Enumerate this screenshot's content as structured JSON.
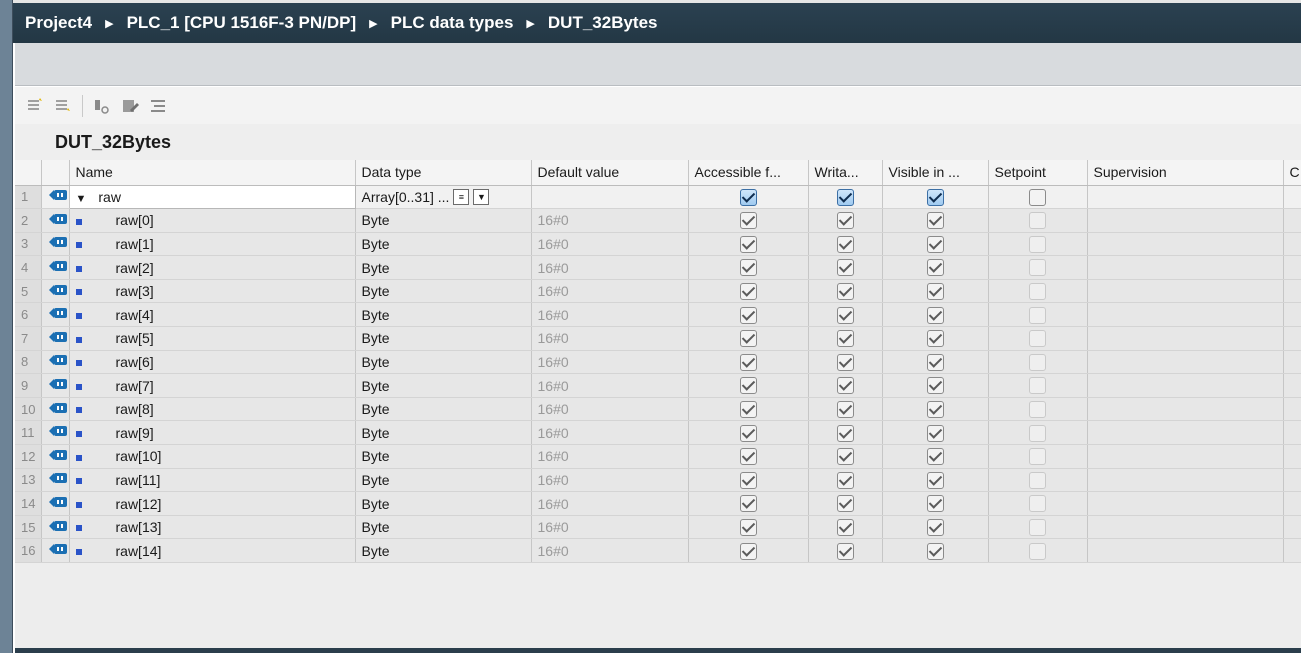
{
  "breadcrumb": [
    "Project4",
    "PLC_1 [CPU 1516F-3 PN/DP]",
    "PLC data types",
    "DUT_32Bytes"
  ],
  "breadcrumb_separator": "▶",
  "block_title": "DUT_32Bytes",
  "columns": {
    "name": "Name",
    "data_type": "Data type",
    "default_value": "Default value",
    "accessible": "Accessible f...",
    "writable": "Writa...",
    "visible": "Visible in ...",
    "setpoint": "Setpoint",
    "supervision": "Supervision",
    "extra": "C"
  },
  "first_row": {
    "num": "1",
    "name": "raw",
    "data_type": "Array[0..31] ...",
    "default_value": "",
    "accessible": true,
    "writable": true,
    "visible": true,
    "setpoint": false
  },
  "rows": [
    {
      "num": "2",
      "name": "raw[0]",
      "data_type": "Byte",
      "default_value": "16#0"
    },
    {
      "num": "3",
      "name": "raw[1]",
      "data_type": "Byte",
      "default_value": "16#0"
    },
    {
      "num": "4",
      "name": "raw[2]",
      "data_type": "Byte",
      "default_value": "16#0"
    },
    {
      "num": "5",
      "name": "raw[3]",
      "data_type": "Byte",
      "default_value": "16#0"
    },
    {
      "num": "6",
      "name": "raw[4]",
      "data_type": "Byte",
      "default_value": "16#0"
    },
    {
      "num": "7",
      "name": "raw[5]",
      "data_type": "Byte",
      "default_value": "16#0"
    },
    {
      "num": "8",
      "name": "raw[6]",
      "data_type": "Byte",
      "default_value": "16#0"
    },
    {
      "num": "9",
      "name": "raw[7]",
      "data_type": "Byte",
      "default_value": "16#0"
    },
    {
      "num": "10",
      "name": "raw[8]",
      "data_type": "Byte",
      "default_value": "16#0"
    },
    {
      "num": "11",
      "name": "raw[9]",
      "data_type": "Byte",
      "default_value": "16#0"
    },
    {
      "num": "12",
      "name": "raw[10]",
      "data_type": "Byte",
      "default_value": "16#0"
    },
    {
      "num": "13",
      "name": "raw[11]",
      "data_type": "Byte",
      "default_value": "16#0"
    },
    {
      "num": "14",
      "name": "raw[12]",
      "data_type": "Byte",
      "default_value": "16#0"
    },
    {
      "num": "15",
      "name": "raw[13]",
      "data_type": "Byte",
      "default_value": "16#0"
    },
    {
      "num": "16",
      "name": "raw[14]",
      "data_type": "Byte",
      "default_value": "16#0"
    }
  ],
  "child_flags": {
    "accessible": true,
    "writable": true,
    "visible": true,
    "setpoint": false
  },
  "toolbar_icons": [
    "insert-row-icon",
    "add-row-icon",
    "monitor-icon",
    "edit-icon",
    "list-icon"
  ],
  "colors": {
    "breadcrumb_bg": "#233744",
    "interface_icon": "#1b6fb3",
    "element_bullet": "#2a53c8"
  }
}
